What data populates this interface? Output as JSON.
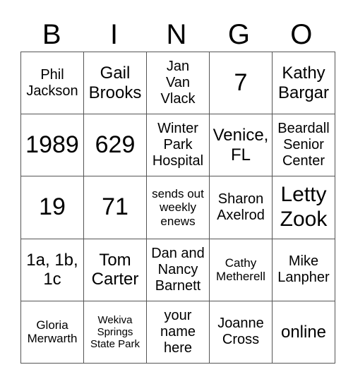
{
  "header": {
    "letters": [
      "B",
      "I",
      "N",
      "G",
      "O"
    ]
  },
  "card": {
    "rows": [
      [
        "Phil\nJackson",
        "Gail\nBrooks",
        "Jan\nVan\nVlack",
        "7",
        "Kathy\nBargar"
      ],
      [
        "1989",
        "629",
        "Winter\nPark\nHospital",
        "Venice,\nFL",
        "Beardall\nSenior\nCenter"
      ],
      [
        "19",
        "71",
        "sends out\nweekly\nenews",
        "Sharon\nAxelrod",
        "Letty\nZook"
      ],
      [
        "1a, 1b,\n1c",
        "Tom\nCarter",
        "Dan and\nNancy\nBarnett",
        "Cathy\nMetherell",
        "Mike\nLanpher"
      ],
      [
        "Gloria\nMerwarth",
        "Wekiva\nSprings\nState Park",
        "your\nname\nhere",
        "Joanne\nCross",
        "online"
      ]
    ]
  }
}
